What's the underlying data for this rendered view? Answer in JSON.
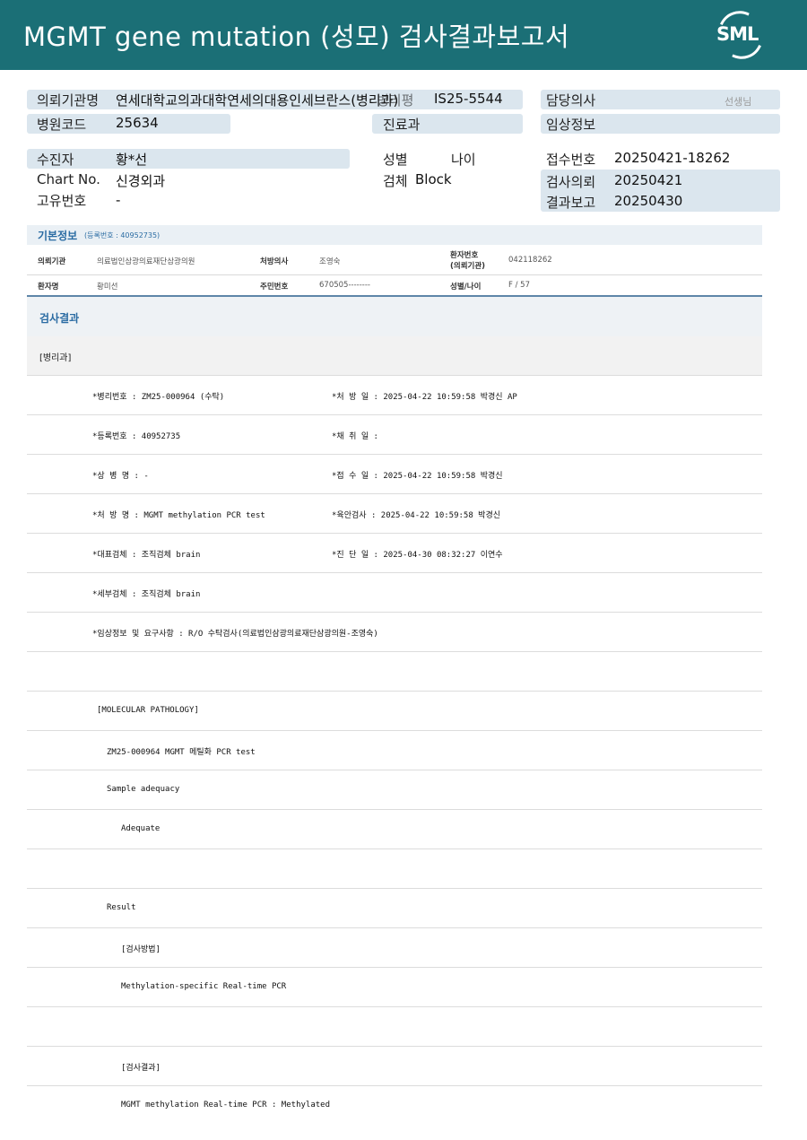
{
  "header": {
    "title": "MGMT gene mutation (성모) 검사결과보고서",
    "logo": "SML"
  },
  "summary": {
    "institution_label": "의뢰기관명",
    "institution_value": "연세대학교의과대학연세의대용인세브란스(병리과)",
    "institution_overlap": "병리평",
    "is_number": "IS25-5544",
    "doctor_label": "담당의사",
    "doctor_suffix": "선생님",
    "hospital_code_label": "병원코드",
    "hospital_code_value": "25634",
    "clinic_label": "진료과",
    "clinical_label": "임상정보",
    "patient_label": "수진자",
    "patient_value": "황*선",
    "gender_label": "성별",
    "age_label": "나이",
    "receipt_label": "접수번호",
    "receipt_value": "20250421-18262",
    "chart_label": "Chart No.",
    "chart_value": "신경외과",
    "specimen_label": "검체",
    "specimen_value": "Block",
    "request_label": "검사의뢰",
    "request_value": "20250421",
    "unique_label": "고유번호",
    "unique_value": "-",
    "report_label": "결과보고",
    "report_value": "20250430"
  },
  "basic": {
    "title": "기본정보",
    "sub": "(등록번호 : 40952735)",
    "r1": {
      "k1": "의뢰기관",
      "v1": "의료법인삼광의료재단삼광의원",
      "k2": "처방의사",
      "v2": "조영숙",
      "k3a": "환자번호",
      "k3b": "(의뢰기관)",
      "v3": "042118262"
    },
    "r2": {
      "k1": "환자명",
      "v1": "황미선",
      "k2": "주민번호",
      "v2": "670505--------",
      "k3": "성별/나이",
      "v3": "F / 57"
    }
  },
  "results": {
    "title": "검사결과",
    "dept": "[병리과]",
    "rows": [
      {
        "a": "*병리번호 : ZM25-000964 (수탁)",
        "b": "*처 방 일 : 2025-04-22 10:59:58  박경신 AP"
      },
      {
        "a": "*등록번호 : 40952735",
        "b": "*채 취 일 :"
      },
      {
        "a": "*상 병 명 : -",
        "b": "*접 수 일 : 2025-04-22 10:59:58  박경신"
      },
      {
        "a": "*처 방 명 : MGMT methylation  PCR test",
        "b": "*육안검사 : 2025-04-22 10:59:58  박경신"
      },
      {
        "a": "*대표검체 : 조직검체 brain",
        "b": "*진 단 일 : 2025-04-30 08:32:27  이연수"
      },
      {
        "a": "*세부검체 : 조직검체 brain",
        "b": ""
      },
      {
        "a": "*임상정보 및 요구사항 : R/O 수탁검사(의료법인삼광의료재단삼광의원-조영숙)",
        "b": ""
      },
      {
        "a": "",
        "b": ""
      },
      {
        "a": "[MOLECULAR PATHOLOGY]",
        "b": ""
      },
      {
        "a": "ZM25-000964    MGMT 메틸화  PCR test",
        "b": ""
      },
      {
        "a": "Sample adequacy",
        "b": ""
      },
      {
        "a": "Adequate",
        "b": ""
      },
      {
        "a": "",
        "b": ""
      },
      {
        "a": "Result",
        "b": ""
      },
      {
        "a": "[검사방법]",
        "b": ""
      },
      {
        "a": "Methylation-specific Real-time PCR",
        "b": ""
      },
      {
        "a": "",
        "b": ""
      },
      {
        "a": "[검사결과]",
        "b": ""
      },
      {
        "a": "MGMT methylation Real-time PCR : Methylated",
        "b": ""
      }
    ]
  },
  "colors": {
    "header_bg": "#1b6f76",
    "pill_bg": "#dbe6ee",
    "accent": "#2b6ca3"
  }
}
